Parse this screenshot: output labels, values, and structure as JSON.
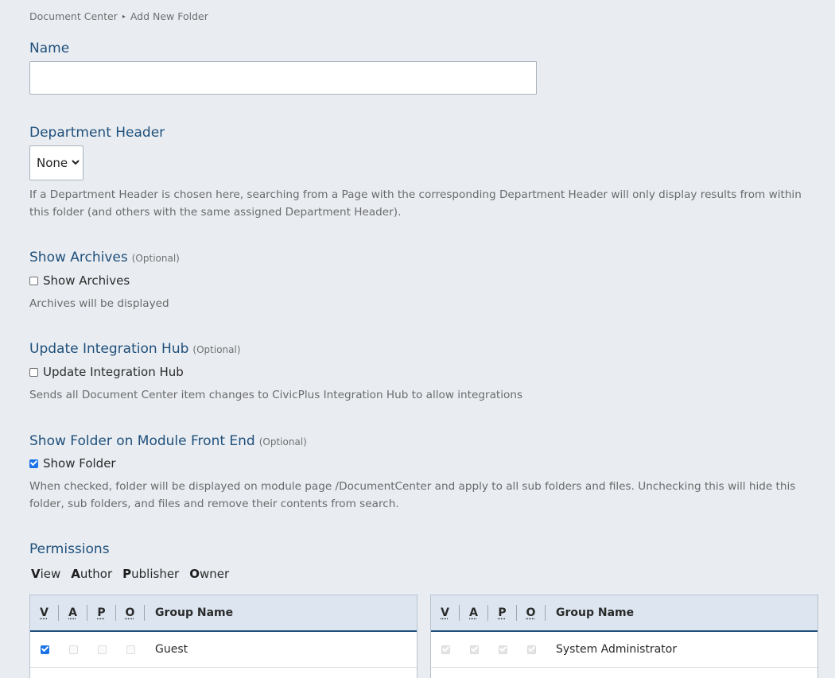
{
  "breadcrumb": {
    "root": "Document Center",
    "separator": "▸",
    "current": "Add New Folder"
  },
  "name_field": {
    "label": "Name",
    "value": "",
    "placeholder": ""
  },
  "department_header": {
    "label": "Department Header",
    "selected": "None",
    "help": "If a Department Header is chosen here, searching from a Page with the corresponding Department Header will only display results from within this folder (and others with the same assigned Department Header)."
  },
  "show_archives": {
    "title": "Show Archives",
    "optional": "(Optional)",
    "checkbox_label": "Show Archives",
    "checked": false,
    "help": "Archives will be displayed"
  },
  "integration_hub": {
    "title": "Update Integration Hub",
    "optional": "(Optional)",
    "checkbox_label": "Update Integration Hub",
    "checked": false,
    "help": "Sends all Document Center item changes to CivicPlus Integration Hub to allow integrations"
  },
  "show_folder": {
    "title": "Show Folder on Module Front End",
    "optional": "(Optional)",
    "checkbox_label": "Show Folder",
    "checked": true,
    "help": "When checked, folder will be displayed on module page /DocumentCenter and apply to all sub folders and files. Unchecking this will hide this folder, sub folders, and files and remove their contents from search."
  },
  "permissions": {
    "title": "Permissions",
    "legend": [
      {
        "key": "V",
        "rest": "iew"
      },
      {
        "key": "A",
        "rest": "uthor"
      },
      {
        "key": "P",
        "rest": "ublisher"
      },
      {
        "key": "O",
        "rest": "wner"
      }
    ],
    "columns": [
      "V",
      "A",
      "P",
      "O"
    ],
    "group_name_header": "Group Name",
    "left_table": {
      "rows": [
        {
          "group": "Guest",
          "v": "checked",
          "a": "disabled",
          "p": "disabled",
          "o": "disabled"
        }
      ]
    },
    "right_table": {
      "rows": [
        {
          "group": "System Administrator",
          "v": "disabled-checked",
          "a": "disabled-checked",
          "p": "disabled-checked",
          "o": "disabled-checked"
        }
      ]
    }
  }
}
